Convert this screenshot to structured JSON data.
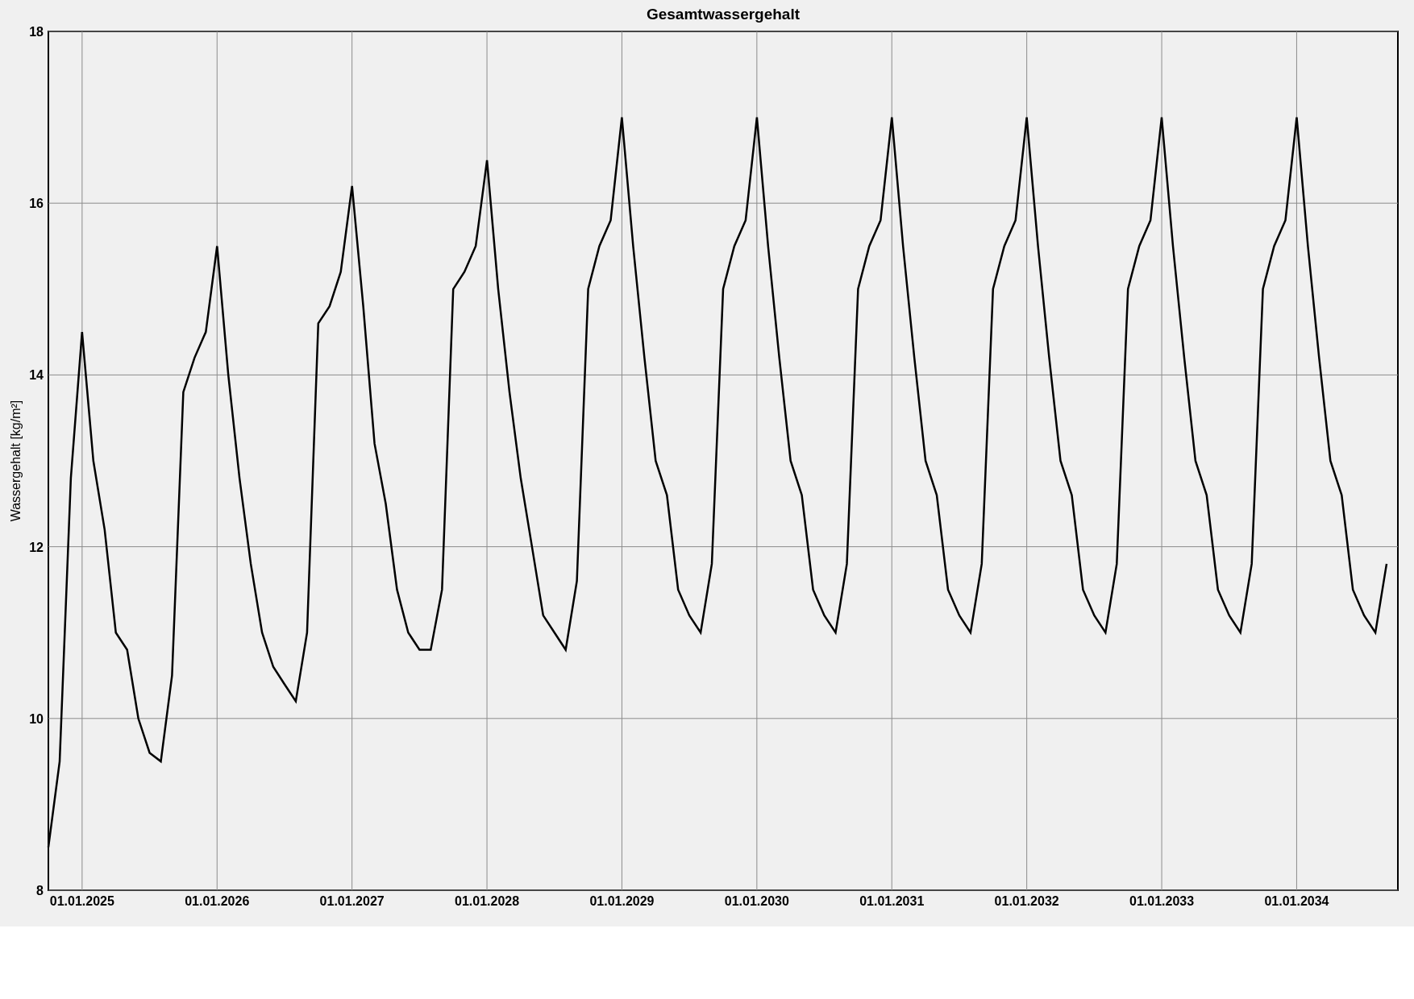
{
  "chart": {
    "chart_data": {
      "type": "line",
      "title": "Gesamtwassergehalt",
      "ylabel": "Wassergehalt [kg/m²]",
      "categories": [
        null,
        null,
        null,
        "01.01.2025",
        null,
        null,
        null,
        null,
        null,
        null,
        null,
        null,
        null,
        null,
        null,
        "01.01.2026",
        null,
        null,
        null,
        null,
        null,
        null,
        null,
        null,
        null,
        null,
        null,
        "01.01.2027",
        null,
        null,
        null,
        null,
        null,
        null,
        null,
        null,
        null,
        null,
        null,
        "01.01.2028",
        null,
        null,
        null,
        null,
        null,
        null,
        null,
        null,
        null,
        null,
        null,
        "01.01.2029",
        null,
        null,
        null,
        null,
        null,
        null,
        null,
        null,
        null,
        null,
        null,
        "01.01.2030",
        null,
        null,
        null,
        null,
        null,
        null,
        null,
        null,
        null,
        null,
        null,
        "01.01.2031",
        null,
        null,
        null,
        null,
        null,
        null,
        null,
        null,
        null,
        null,
        null,
        "01.01.2032",
        null,
        null,
        null,
        null,
        null,
        null,
        null,
        null,
        null,
        null,
        null,
        "01.01.2033",
        null,
        null,
        null,
        null,
        null,
        null,
        null,
        null,
        null,
        null,
        null,
        "01.01.2034",
        null,
        null,
        null,
        null,
        null,
        null,
        null,
        null
      ],
      "series": [
        {
          "color": "#000000",
          "values": [
            8.5,
            9.5,
            12.8,
            14.5,
            13.0,
            12.2,
            11.0,
            10.8,
            10.0,
            9.6,
            9.5,
            10.5,
            13.8,
            14.2,
            14.5,
            15.5,
            14.0,
            12.8,
            11.8,
            11.0,
            10.6,
            10.4,
            10.2,
            11.0,
            14.6,
            14.8,
            15.2,
            16.2,
            14.8,
            13.2,
            12.5,
            11.5,
            11.0,
            10.8,
            10.8,
            11.5,
            15.0,
            15.2,
            15.5,
            16.5,
            15.0,
            13.8,
            12.8,
            12.0,
            11.2,
            11.0,
            10.8,
            11.6,
            15.0,
            15.5,
            15.8,
            17.0,
            15.5,
            14.2,
            13.0,
            12.6,
            11.5,
            11.2,
            11.0,
            11.8,
            15.0,
            15.5,
            15.8,
            17.0,
            15.5,
            14.2,
            13.0,
            12.6,
            11.5,
            11.2,
            11.0,
            11.8,
            15.0,
            15.5,
            15.8,
            17.0,
            15.5,
            14.2,
            13.0,
            12.6,
            11.5,
            11.2,
            11.0,
            11.8,
            15.0,
            15.5,
            15.8,
            17.0,
            15.5,
            14.2,
            13.0,
            12.6,
            11.5,
            11.2,
            11.0,
            11.8,
            15.0,
            15.5,
            15.8,
            17.0,
            15.5,
            14.2,
            13.0,
            12.6,
            11.5,
            11.2,
            11.0,
            11.8,
            15.0,
            15.5,
            15.8,
            17.0,
            15.5,
            14.2,
            13.0,
            12.6,
            11.5,
            11.2,
            11.0,
            11.8
          ]
        }
      ],
      "ylim": [
        8,
        18
      ],
      "grid": true,
      "yticks": [
        8,
        10,
        12,
        14,
        16,
        18
      ]
    }
  }
}
